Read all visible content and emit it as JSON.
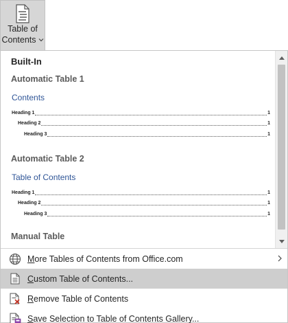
{
  "ribbon_button": {
    "line1": "Table of",
    "line2": "Contents",
    "icon": "document-toc-icon"
  },
  "gallery": {
    "section_header": "Built-In",
    "styles": [
      {
        "title": "Automatic Table 1",
        "heading": "Contents",
        "entries": [
          {
            "text": "Heading 1",
            "page": "1",
            "level": 1
          },
          {
            "text": "Heading 2",
            "page": "1",
            "level": 2
          },
          {
            "text": "Heading 3",
            "page": "1",
            "level": 3
          }
        ]
      },
      {
        "title": "Automatic Table 2",
        "heading": "Table of Contents",
        "entries": [
          {
            "text": "Heading 1",
            "page": "1",
            "level": 1
          },
          {
            "text": "Heading 2",
            "page": "1",
            "level": 2
          },
          {
            "text": "Heading 3",
            "page": "1",
            "level": 3
          }
        ]
      },
      {
        "title": "Manual Table"
      }
    ]
  },
  "menu": {
    "items": [
      {
        "accel": "M",
        "rest": "ore Tables of Contents from Office.com",
        "icon": "globe-icon",
        "has_submenu": true,
        "selected": false
      },
      {
        "accel": "C",
        "rest": "ustom Table of Contents...",
        "icon": "document-icon",
        "has_submenu": false,
        "selected": true
      },
      {
        "accel": "R",
        "rest": "emove Table of Contents",
        "icon": "remove-document-icon",
        "has_submenu": false,
        "selected": false
      },
      {
        "accel": "S",
        "rest": "ave Selection to Table of Contents Gallery...",
        "icon": "save-to-gallery-icon",
        "has_submenu": false,
        "selected": false
      }
    ]
  },
  "colors": {
    "toc_heading": "#2f5597",
    "selected_bg": "#cecece",
    "ribbon_bg": "#d6d6d6"
  }
}
